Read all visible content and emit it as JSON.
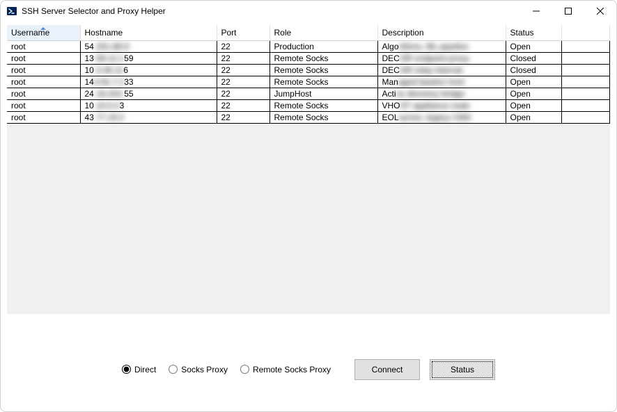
{
  "window": {
    "title": "SSH Server Selector and Proxy Helper"
  },
  "columns": {
    "username": "Username",
    "hostname": "Hostname",
    "port": "Port",
    "role": "Role",
    "description": "Description",
    "status": "Status"
  },
  "rows": [
    {
      "username": "root",
      "hostname_vis": "54",
      "hostname_blur": ".201.88.9",
      "port": "22",
      "role": "Production",
      "desc_vis": "Algo",
      "desc_blur": "rithms, ML pipeline",
      "status": "Open"
    },
    {
      "username": "root",
      "hostname_vis": "13",
      "hostname_blur": ".58.12.1",
      "hostname_tail": "59",
      "port": "22",
      "role": "Remote Socks",
      "desc_vis": "DEC",
      "desc_blur": "OR endpoint proxy",
      "status": "Closed"
    },
    {
      "username": "root",
      "hostname_vis": "10",
      "hostname_blur": ".0.45.11",
      "hostname_tail": "6",
      "port": "22",
      "role": "Remote Socks",
      "desc_vis": "DEC",
      "desc_blur": "OR relay internal",
      "status": "Closed"
    },
    {
      "username": "root",
      "hostname_vis": "14",
      "hostname_blur": "4.91.7.2",
      "hostname_tail": "33",
      "port": "22",
      "role": "Remote Socks",
      "desc_vis": "Man",
      "desc_blur": "aged bastion host",
      "status": "Open"
    },
    {
      "username": "root",
      "hostname_vis": "24",
      "hostname_blur": ".18.203.",
      "hostname_tail": "55",
      "port": "22",
      "role": "JumpHost",
      "desc_vis": "Acti",
      "desc_blur": "ve directory bridge",
      "status": "Open"
    },
    {
      "username": "root",
      "hostname_vis": "10",
      "hostname_blur": ".10.0.4",
      "hostname_tail": "3",
      "port": "22",
      "role": "Remote Socks",
      "desc_vis": "VHO",
      "desc_blur": "ST appliance node",
      "status": "Open"
    },
    {
      "username": "root",
      "hostname_vis": "43",
      "hostname_blur": ".77.19.2",
      "port": "22",
      "role": "Remote Socks",
      "desc_vis": "EOL",
      "desc_blur": " server, legacy CMS",
      "status": "Open"
    }
  ],
  "radios": {
    "direct": "Direct",
    "socks": "Socks Proxy",
    "remote": "Remote Socks Proxy"
  },
  "buttons": {
    "connect": "Connect",
    "status": "Status"
  }
}
